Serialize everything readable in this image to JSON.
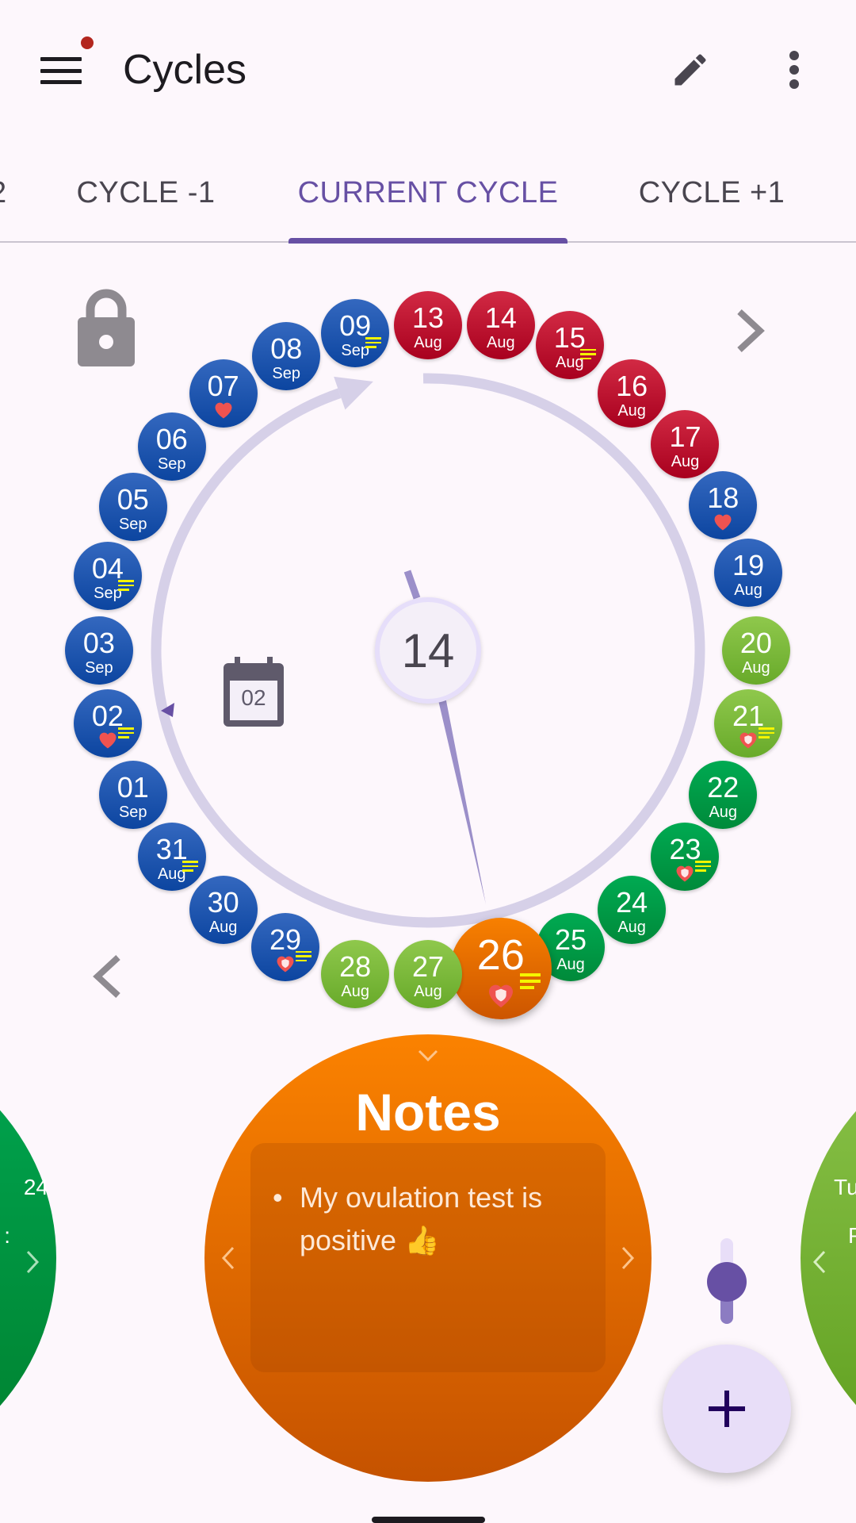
{
  "app_bar": {
    "title": "Cycles",
    "menu_icon": "hamburger-menu-icon",
    "has_notification_dot": true,
    "edit_icon": "pencil-icon",
    "more_icon": "more-vert-icon"
  },
  "tabs": [
    {
      "label": "2",
      "active": false
    },
    {
      "label": "CYCLE -1",
      "active": false
    },
    {
      "label": "CURRENT CYCLE",
      "active": true
    },
    {
      "label": "CYCLE +1",
      "active": false
    }
  ],
  "colors": {
    "accent": "#6750a4",
    "red": "#c41232",
    "blue": "#1e56ad",
    "light_green": "#7cbc3a",
    "dark_green": "#00994a",
    "orange": "#f07800"
  },
  "dial": {
    "center_value": "14",
    "calendar_day": "02",
    "locked": true,
    "days": [
      {
        "day": "13",
        "month": "Aug",
        "color": "red"
      },
      {
        "day": "14",
        "month": "Aug",
        "color": "red"
      },
      {
        "day": "15",
        "month": "Aug",
        "color": "red",
        "notes": true
      },
      {
        "day": "16",
        "month": "Aug",
        "color": "red"
      },
      {
        "day": "17",
        "month": "Aug",
        "color": "red"
      },
      {
        "day": "18",
        "color": "blue",
        "marker": "heart"
      },
      {
        "day": "19",
        "month": "Aug",
        "color": "blue"
      },
      {
        "day": "20",
        "month": "Aug",
        "color": "light_green"
      },
      {
        "day": "21",
        "color": "light_green",
        "marker": "heart-shield",
        "notes": true
      },
      {
        "day": "22",
        "month": "Aug",
        "color": "dark_green"
      },
      {
        "day": "23",
        "color": "dark_green",
        "marker": "heart-shield",
        "notes": true
      },
      {
        "day": "24",
        "month": "Aug",
        "color": "dark_green"
      },
      {
        "day": "25",
        "month": "Aug",
        "color": "dark_green"
      },
      {
        "day": "26",
        "color": "orange",
        "marker": "heart-shield",
        "notes": true,
        "selected": true
      },
      {
        "day": "27",
        "month": "Aug",
        "color": "light_green"
      },
      {
        "day": "28",
        "month": "Aug",
        "color": "light_green"
      },
      {
        "day": "29",
        "color": "blue",
        "marker": "heart-shield",
        "notes": true
      },
      {
        "day": "30",
        "month": "Aug",
        "color": "blue"
      },
      {
        "day": "31",
        "month": "Aug",
        "color": "blue",
        "notes": true
      },
      {
        "day": "01",
        "month": "Sep",
        "color": "blue"
      },
      {
        "day": "02",
        "color": "blue",
        "marker": "heart",
        "notes": true
      },
      {
        "day": "03",
        "month": "Sep",
        "color": "blue"
      },
      {
        "day": "04",
        "month": "Sep",
        "color": "blue",
        "notes": true
      },
      {
        "day": "05",
        "month": "Sep",
        "color": "blue"
      },
      {
        "day": "06",
        "month": "Sep",
        "color": "blue"
      },
      {
        "day": "07",
        "color": "blue",
        "marker": "heart"
      },
      {
        "day": "08",
        "month": "Sep",
        "color": "blue"
      },
      {
        "day": "09",
        "month": "Sep",
        "color": "blue",
        "notes": true
      }
    ]
  },
  "notes_card": {
    "title": "Notes",
    "items": [
      "My ovulation test is positive 👍"
    ]
  },
  "left_card": {
    "line1": "24",
    "line2": ":"
  },
  "right_card": {
    "line1": "Tu",
    "line2": "P"
  },
  "zoom_slider": {
    "value": 0.5
  },
  "fab": {
    "icon": "plus-icon"
  }
}
